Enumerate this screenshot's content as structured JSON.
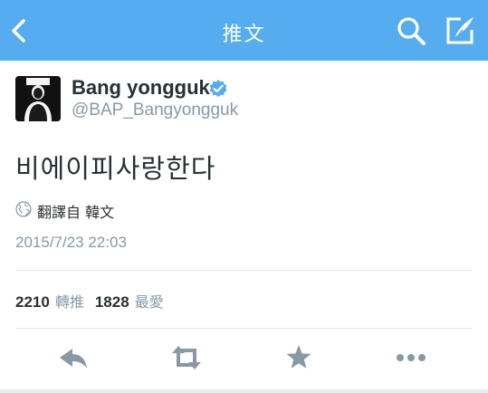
{
  "navbar": {
    "title": "推文",
    "back_icon": "back-chevron-icon",
    "search_icon": "search-icon",
    "compose_icon": "compose-icon",
    "background_color": "#55acee"
  },
  "tweet": {
    "user_name": "Bang yongguk",
    "verified_icon": "verified-badge-icon",
    "handle": "@BAP_Bangyongguk",
    "text": "비에이피사랑한다",
    "translate_label": "翻譯自 韓文",
    "timestamp": "2015/7/23 22:03"
  },
  "stats": {
    "retweets_count": "2210",
    "retweets_label": "轉推",
    "favorites_count": "1828",
    "favorites_label": "最愛"
  },
  "actions": [
    "reply-icon",
    "retweet-icon",
    "favorite-star-icon",
    "more-dots-icon"
  ],
  "colors": {
    "accent": "#55acee",
    "icon_gray": "#8899a6",
    "verified": "#55acee",
    "text": "#292f33"
  }
}
